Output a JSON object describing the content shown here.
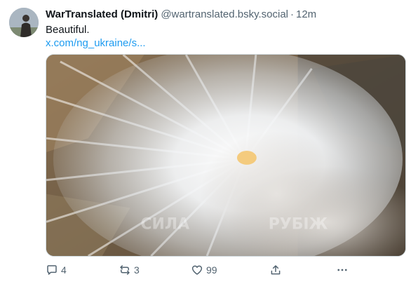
{
  "post": {
    "author": {
      "display_name": "WarTranslated (Dmitri)",
      "handle": "@wartranslated.bsky.social",
      "avatar_icon": "user-avatar"
    },
    "separator": "·",
    "timestamp": "12m",
    "text": "Beautiful.",
    "link_text": "x.com/ng_ukraine/s...",
    "media": {
      "description_icon": "drone-strike-video-thumbnail",
      "watermarks": [
        "СИЛА",
        "РУБІЖ"
      ]
    },
    "actions": {
      "reply": {
        "icon": "reply-icon",
        "count": "4"
      },
      "repost": {
        "icon": "repost-icon",
        "count": "3"
      },
      "like": {
        "icon": "heart-icon",
        "count": "99"
      },
      "share": {
        "icon": "share-icon"
      },
      "more": {
        "icon": "more-icon"
      }
    }
  },
  "colors": {
    "text_primary": "#0f1419",
    "text_secondary": "#536471",
    "link": "#1d9bf0",
    "border": "#cfd9de"
  }
}
